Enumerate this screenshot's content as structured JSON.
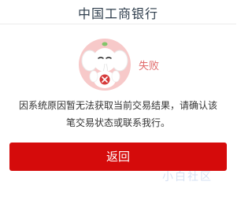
{
  "header": {
    "title": "中国工商银行"
  },
  "result": {
    "status_label": "失败",
    "message": "因系统原因暂无法获取当前交易结果，请确认该笔交易状态或联系我行。",
    "mascot_icon": "elephant-fail-icon"
  },
  "actions": {
    "back_label": "返回"
  },
  "watermark": {
    "text": "小白社区"
  },
  "colors": {
    "accent_red": "#d50b0b",
    "status_red": "#e06b6b",
    "title_color": "#2f3e4d"
  }
}
